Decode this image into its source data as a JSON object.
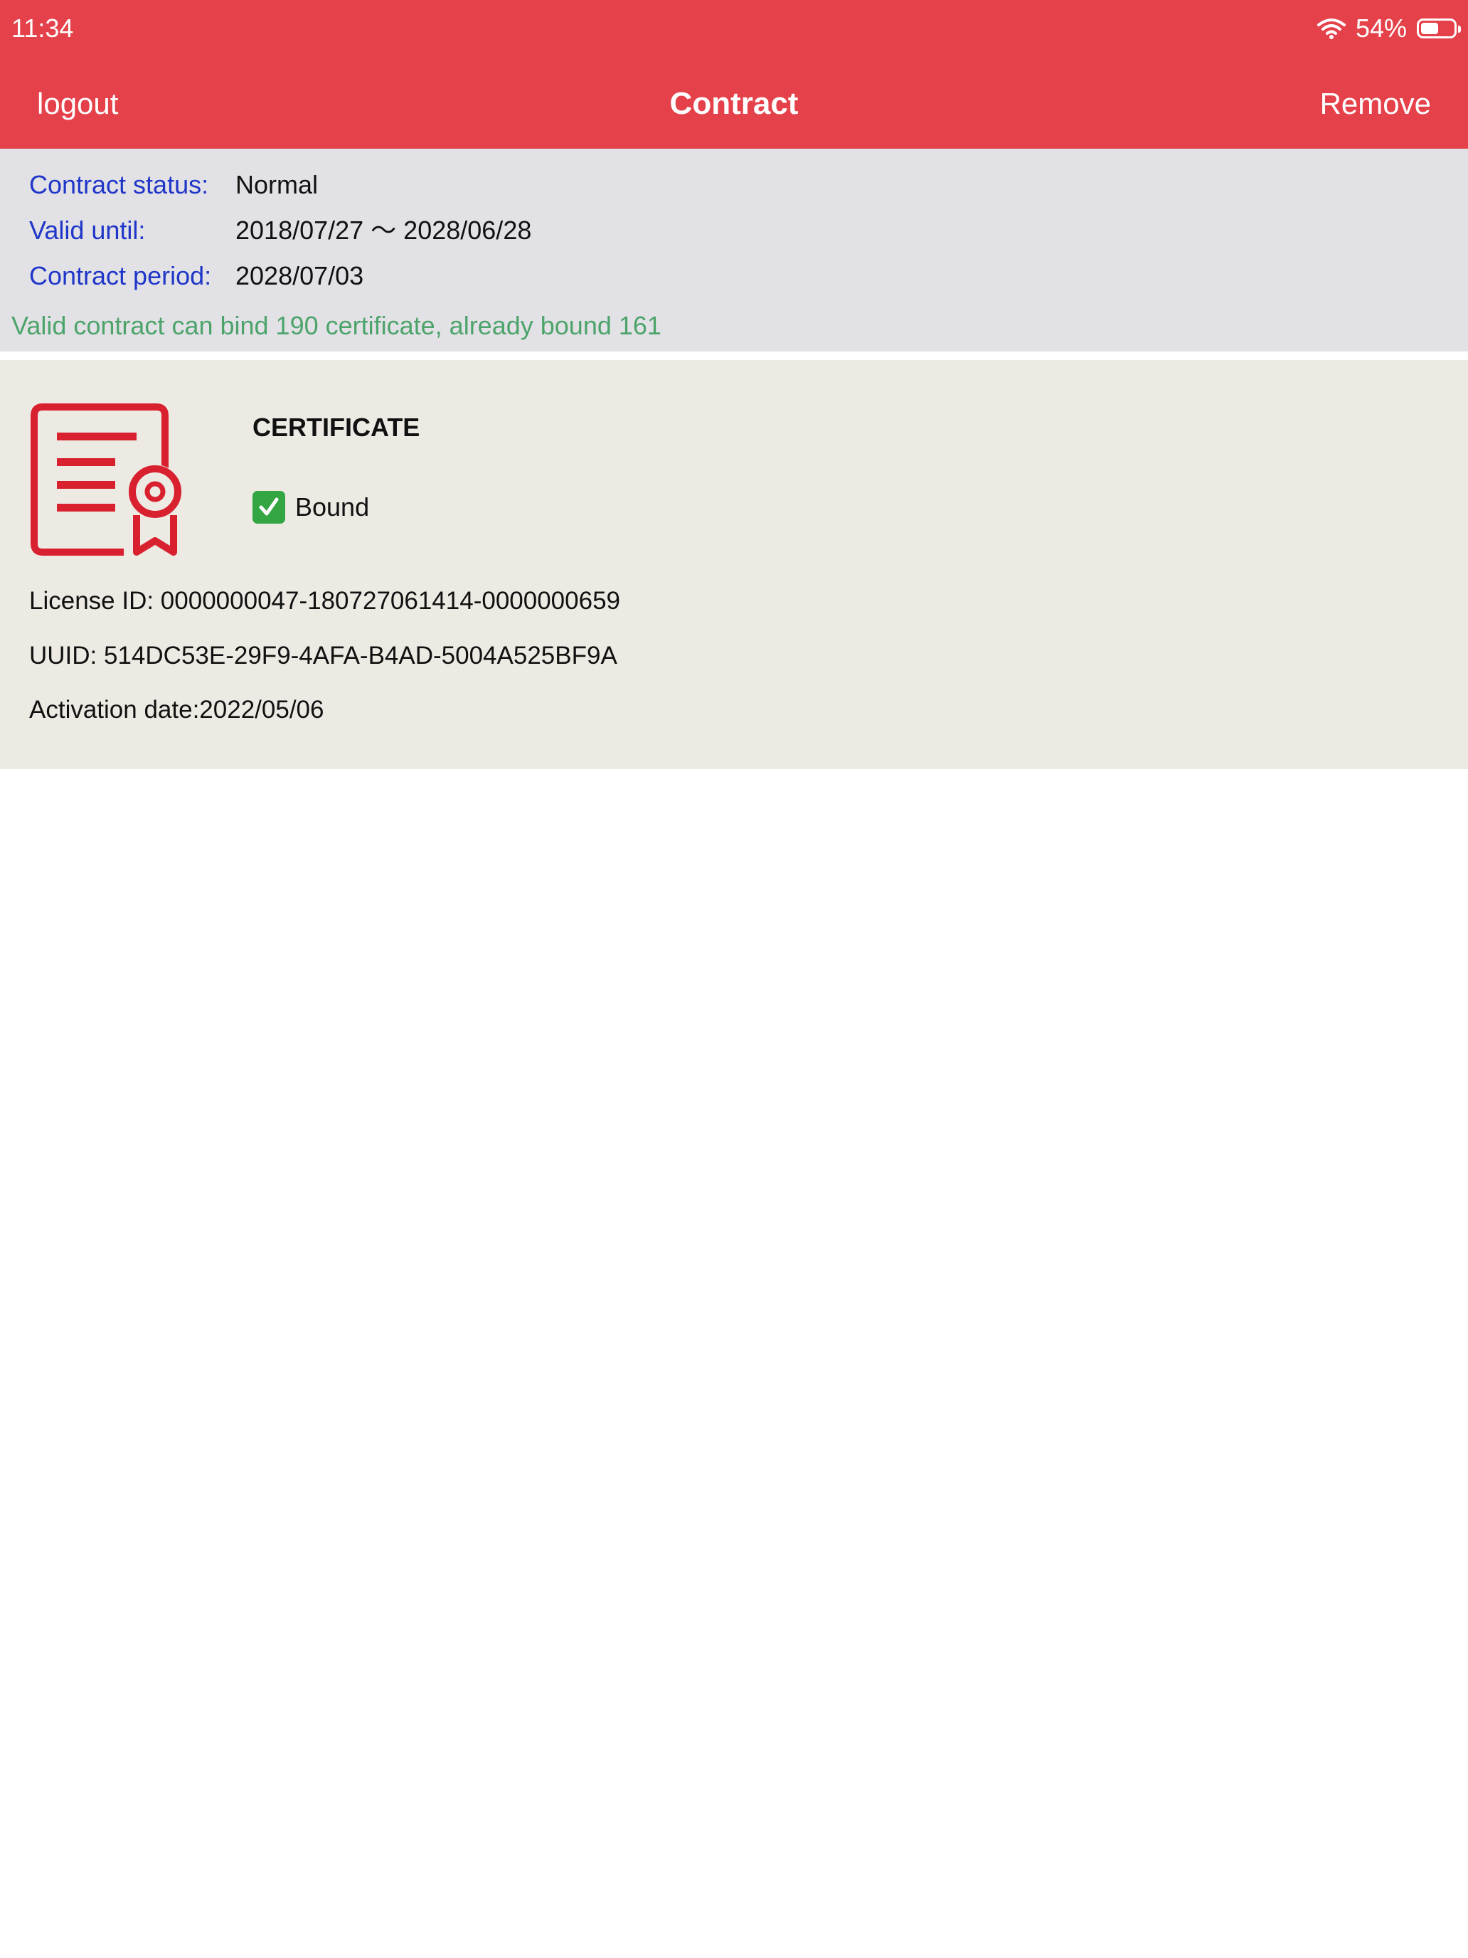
{
  "status_bar": {
    "time": "11:34",
    "battery_percent": "54%",
    "battery_level": 0.54
  },
  "nav": {
    "left_label": "logout",
    "title": "Contract",
    "right_label": "Remove"
  },
  "contract": {
    "rows": [
      {
        "label": "Contract status:",
        "value": "Normal"
      },
      {
        "label": "Valid until:",
        "value": "2018/07/27 〜 2028/06/28"
      },
      {
        "label": "Contract period:",
        "value": "2028/07/03"
      }
    ],
    "note": "Valid contract can bind 190 certificate, already bound 161"
  },
  "certificate": {
    "title": "CERTIFICATE",
    "status": "Bound",
    "license_id": "License ID: 0000000047-180727061414-0000000659",
    "uuid": "UUID: 514DC53E-29F9-4AFA-B4AD-5004A525BF9A",
    "activation_date": "Activation date:2022/05/06"
  },
  "colors": {
    "header_red": "#E5414A",
    "label_blue": "#1F36C9",
    "note_green": "#4CA46B",
    "icon_red": "#D8202E",
    "check_green": "#34A543"
  }
}
